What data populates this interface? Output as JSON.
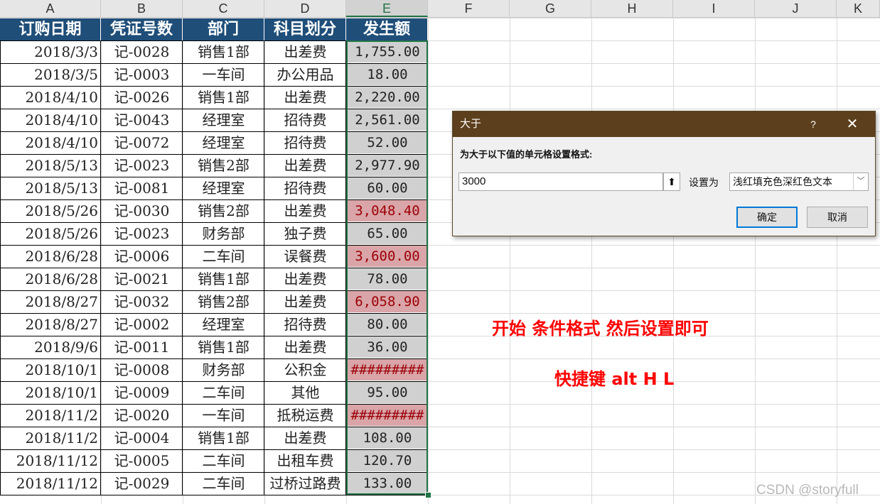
{
  "columns": [
    "A",
    "B",
    "C",
    "D",
    "E",
    "F",
    "G",
    "H",
    "I",
    "J",
    "K"
  ],
  "headers": [
    "订购日期",
    "凭证号数",
    "部门",
    "科目划分",
    "发生额"
  ],
  "rows": [
    {
      "date": "2018/3/3",
      "voucher": "记-0028",
      "dept": "销售1部",
      "subject": "出差费",
      "amount": "1,755.00",
      "hi": false
    },
    {
      "date": "2018/3/5",
      "voucher": "记-0003",
      "dept": "一车间",
      "subject": "办公用品",
      "amount": "18.00",
      "hi": false
    },
    {
      "date": "2018/4/10",
      "voucher": "记-0026",
      "dept": "销售1部",
      "subject": "出差费",
      "amount": "2,220.00",
      "hi": false
    },
    {
      "date": "2018/4/10",
      "voucher": "记-0043",
      "dept": "经理室",
      "subject": "招待费",
      "amount": "2,561.00",
      "hi": false
    },
    {
      "date": "2018/4/10",
      "voucher": "记-0072",
      "dept": "经理室",
      "subject": "招待费",
      "amount": "52.00",
      "hi": false
    },
    {
      "date": "2018/5/13",
      "voucher": "记-0023",
      "dept": "销售2部",
      "subject": "出差费",
      "amount": "2,977.90",
      "hi": false
    },
    {
      "date": "2018/5/13",
      "voucher": "记-0081",
      "dept": "经理室",
      "subject": "招待费",
      "amount": "60.00",
      "hi": false
    },
    {
      "date": "2018/5/26",
      "voucher": "记-0030",
      "dept": "销售2部",
      "subject": "出差费",
      "amount": "3,048.40",
      "hi": true
    },
    {
      "date": "2018/5/26",
      "voucher": "记-0023",
      "dept": "财务部",
      "subject": "独子费",
      "amount": "65.00",
      "hi": false
    },
    {
      "date": "2018/6/28",
      "voucher": "记-0006",
      "dept": "二车间",
      "subject": "误餐费",
      "amount": "3,600.00",
      "hi": true
    },
    {
      "date": "2018/6/28",
      "voucher": "记-0021",
      "dept": "销售1部",
      "subject": "出差费",
      "amount": "78.00",
      "hi": false
    },
    {
      "date": "2018/8/27",
      "voucher": "记-0032",
      "dept": "销售2部",
      "subject": "出差费",
      "amount": "6,058.90",
      "hi": true
    },
    {
      "date": "2018/8/27",
      "voucher": "记-0002",
      "dept": "经理室",
      "subject": "招待费",
      "amount": "80.00",
      "hi": false
    },
    {
      "date": "2018/9/6",
      "voucher": "记-0011",
      "dept": "销售1部",
      "subject": "出差费",
      "amount": "36.00",
      "hi": false
    },
    {
      "date": "2018/10/1",
      "voucher": "记-0008",
      "dept": "财务部",
      "subject": "公积金",
      "amount": "#########",
      "hi": true
    },
    {
      "date": "2018/10/1",
      "voucher": "记-0009",
      "dept": "二车间",
      "subject": "其他",
      "amount": "95.00",
      "hi": false
    },
    {
      "date": "2018/11/2",
      "voucher": "记-0020",
      "dept": "一车间",
      "subject": "抵税运费",
      "amount": "#########",
      "hi": true
    },
    {
      "date": "2018/11/2",
      "voucher": "记-0004",
      "dept": "销售1部",
      "subject": "出差费",
      "amount": "108.00",
      "hi": false
    },
    {
      "date": "2018/11/12",
      "voucher": "记-0005",
      "dept": "二车间",
      "subject": "出租车费",
      "amount": "120.70",
      "hi": false
    },
    {
      "date": "2018/11/12",
      "voucher": "记-0029",
      "dept": "二车间",
      "subject": "过桥过路费",
      "amount": "133.00",
      "hi": false
    }
  ],
  "dialog": {
    "title": "大于",
    "help": "?",
    "close": "✕",
    "prompt": "为大于以下值的单元格设置格式:",
    "value": "3000",
    "collapse_icon": "⬆",
    "format_label": "设置为",
    "format_value": "浅红填充色深红色文本",
    "dropdown_icon": "﹀",
    "ok": "确定",
    "cancel": "取消"
  },
  "notes": {
    "line1": "开始  条件格式 然后设置即可",
    "line2": "快捷键 alt H L"
  },
  "watermark": "CSDN @storyfull",
  "colors": {
    "header_bg": "#1f4e79",
    "highlight_fill": "#d9a5a8",
    "highlight_text": "#9c0006",
    "note": "#ff0000",
    "title_bar": "#5c3f1c"
  }
}
